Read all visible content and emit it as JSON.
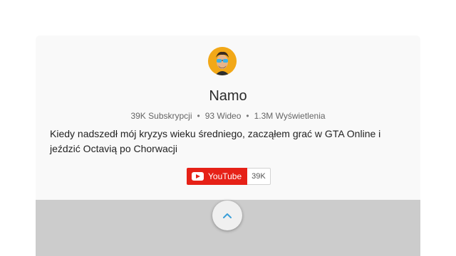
{
  "channel": {
    "name": "Namo",
    "avatar_icon": "avatar-icon",
    "subscribers": "39K Subskrypcji",
    "videos": "93 Wideo",
    "views": "1.3M Wyświetlenia",
    "description": "Kiedy nadszedł mój kryzys wieku średniego, zacząłem grać w GTA Online i jeździć Octavią po Chorwacji"
  },
  "subscribe": {
    "label": "YouTube",
    "count": "39K",
    "icon": "youtube-logo-icon",
    "color": "#e62117"
  },
  "scroll": {
    "icon": "chevron-up-icon",
    "color": "#3b9fd8"
  },
  "colors": {
    "card_bg": "#f9f9f9",
    "bottom_bg": "#cccccc"
  }
}
